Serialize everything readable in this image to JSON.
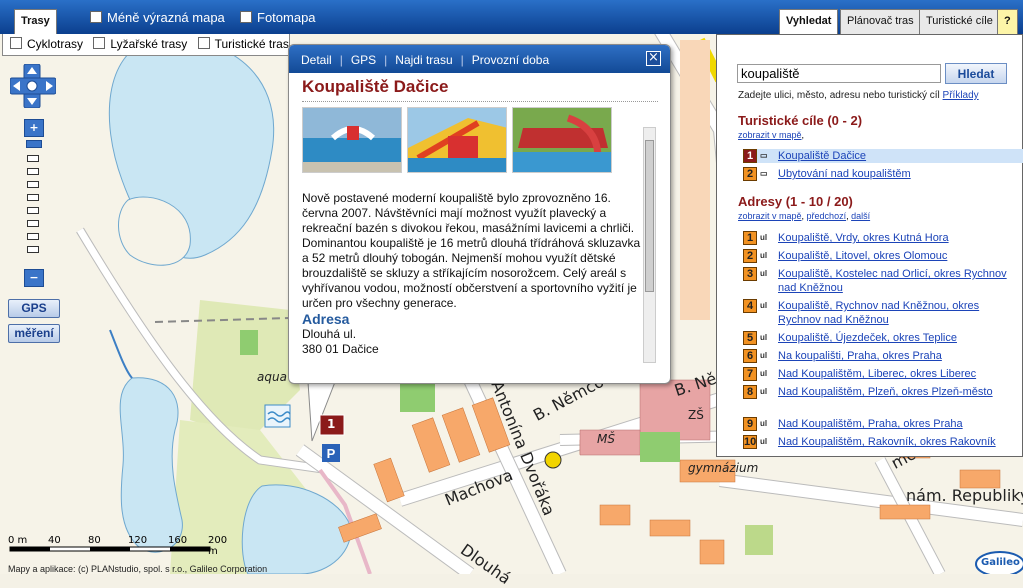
{
  "top_tabs": {
    "routes": "Trasy",
    "search": "Vyhledat",
    "planner": "Plánovač tras",
    "tourist": "Turistické cíle",
    "help": "?"
  },
  "top_checks": {
    "less_map": "Méně výrazná mapa",
    "photomap": "Fotomapa"
  },
  "layers": [
    "Cyklotrasy",
    "Lyžařské trasy",
    "Turistické trasy"
  ],
  "controls": {
    "gps": "GPS",
    "measure": "měření",
    "zoom_in": "+",
    "zoom_out": "−"
  },
  "popup": {
    "nav": [
      "Detail",
      "GPS",
      "Najdi trasu",
      "Provozní doba"
    ],
    "close": "×",
    "title": "Koupaliště Dačice",
    "description": "Nově postavené moderní koupaliště bylo zprovozněno 16. června 2007. Návštěvníci mají možnost využít plavecký a rekreační bazén s divokou řekou, masážními lavicemi a chrliči. Dominantou koupaliště je 16 metrů dlouhá třídráhová skluzavka a 52 metrů dlouhý tobogán. Nejmenší mohou využít dětské brouzdaliště se skluzy a stříkajícím nosorožcem. Celý areál s vyhřívanou vodou, možností občerstvení a sportovního vyžití je určen pro všechny generace.",
    "address_heading": "Adresa",
    "address_line1": "Dlouhá ul.",
    "address_line2": "380 01 Dačice"
  },
  "search": {
    "value": "koupaliště",
    "button": "Hledat",
    "hint": "Zadejte ulici, město, adresu nebo turistický cíl",
    "hint_link": "Příklady"
  },
  "tourist_section": {
    "heading": "Turistické cíle (0 - 2)",
    "sub_link": "zobrazit v mapě",
    "results": [
      {
        "num": "1",
        "text": "Koupaliště Dačice"
      },
      {
        "num": "2",
        "text": "Ubytování nad koupalištěm"
      }
    ]
  },
  "address_section": {
    "heading": "Adresy (1 - 10 / 20)",
    "sub_links": [
      "zobrazit v mapě",
      "předchozí",
      "další"
    ],
    "results": [
      {
        "num": "1",
        "text": "Koupaliště, Vrdy, okres Kutná Hora"
      },
      {
        "num": "2",
        "text": "Koupaliště, Litovel, okres Olomouc"
      },
      {
        "num": "3",
        "text": "Koupaliště, Kostelec nad Orlicí, okres Rychnov nad Kněžnou"
      },
      {
        "num": "4",
        "text": "Koupaliště, Rychnov nad Kněžnou, okres Rychnov nad Kněžnou"
      },
      {
        "num": "5",
        "text": "Koupaliště, Újezdeček, okres Teplice"
      },
      {
        "num": "6",
        "text": "Na koupališti, Praha, okres Praha"
      },
      {
        "num": "7",
        "text": "Nad Koupalištěm, Liberec, okres Liberec"
      },
      {
        "num": "8",
        "text": "Nad Koupalištěm, Plzeň, okres Plzeň-město"
      },
      {
        "num": "9",
        "text": "Nad Koupalištěm, Praha, okres Praha"
      },
      {
        "num": "10",
        "text": "Nad Koupalištěm, Rakovník, okres Rakovník"
      }
    ]
  },
  "map_labels": {
    "street1": "B. Němcové",
    "street2": "Machova",
    "street3": "Antonína Dvořáka",
    "street4": "Dlouhá",
    "street5": "nám. Republiky",
    "street6": "B. Ně",
    "street7": "mcové",
    "zs": "ZŠ",
    "ms": "MŠ",
    "gym": "gymnázium",
    "aqua": "aqua",
    "marker": "1"
  },
  "scale": {
    "ticks": [
      "0 m",
      "40",
      "80",
      "120",
      "160",
      "200 m"
    ]
  },
  "copyright": "Mapy a aplikace: (c) PLANstudio, spol. s r.o., Galileo Corporation",
  "brand": "Galileo",
  "colors": {
    "water": "#c9e6f3",
    "road": "#ffffff",
    "building": "#f7a86a",
    "panel_title": "#8b1a1a",
    "link": "#1c44b8"
  }
}
